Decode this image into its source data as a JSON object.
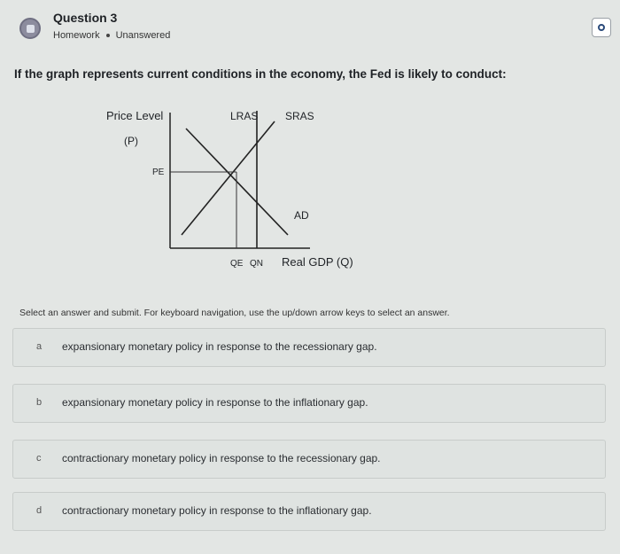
{
  "header": {
    "title": "Question 3",
    "meta": {
      "category": "Homework",
      "status": "Unanswered"
    }
  },
  "question_text": "If the graph represents current conditions in the economy, the Fed is likely to conduct:",
  "graph": {
    "y_axis_label": "Price Level",
    "y_axis_sub": "(P)",
    "price_marker": "PE",
    "curve_labels": {
      "lras": "LRAS",
      "sras": "SRAS",
      "ad": "AD"
    },
    "x_ticks": [
      "QE",
      "QN"
    ],
    "x_axis_label": "Real GDP (Q)"
  },
  "instruction": "Select an answer and submit. For keyboard navigation, use the up/down arrow keys to select an answer.",
  "options": [
    {
      "letter": "a",
      "text": "expansionary monetary policy in response to the recessionary gap."
    },
    {
      "letter": "b",
      "text": "expansionary monetary policy in response to the inflationary gap."
    },
    {
      "letter": "c",
      "text": "contractionary monetary policy in response to the recessionary gap."
    },
    {
      "letter": "d",
      "text": "contractionary monetary policy in response to the inflationary gap."
    }
  ]
}
